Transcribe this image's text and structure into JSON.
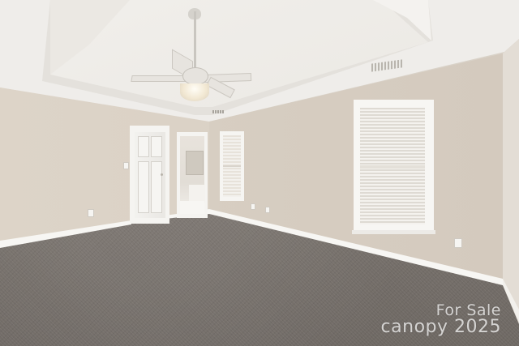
{
  "watermark": {
    "line1": "For Sale",
    "brand": "canopy 2025"
  },
  "colors": {
    "wall": "#d7cec2",
    "ceiling": "#efedea",
    "carpet": "#7b756f",
    "trim": "#f7f6f3"
  }
}
